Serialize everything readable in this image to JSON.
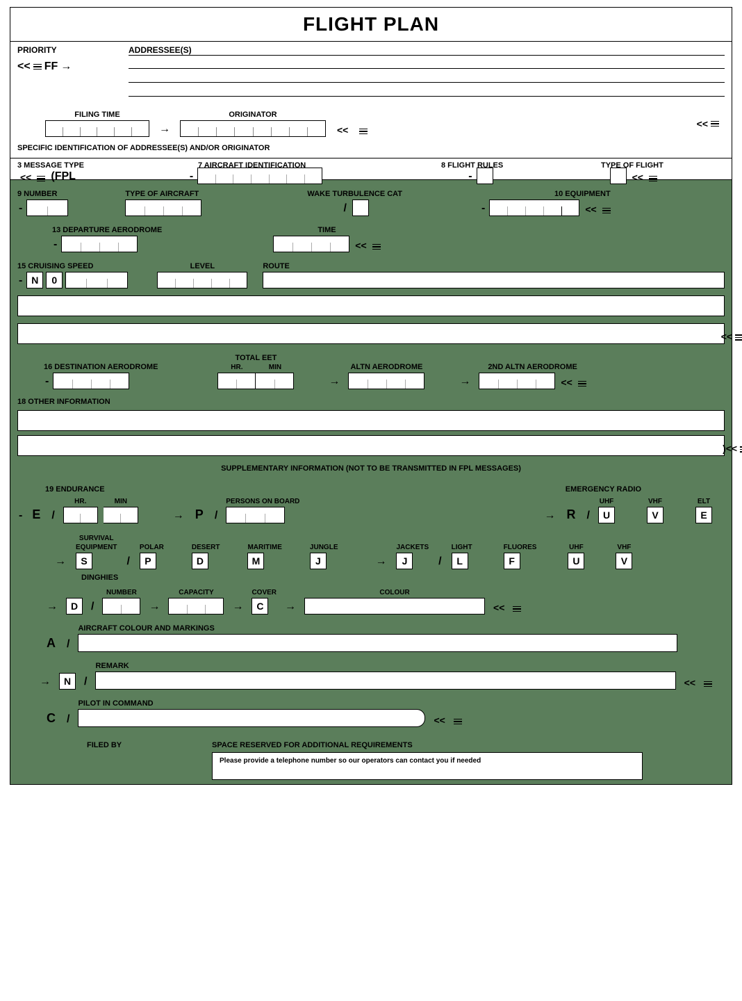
{
  "title": "FLIGHT PLAN",
  "top": {
    "priority": "PRIORITY",
    "addressees": "ADDRESSEE(S)",
    "ff": "FF",
    "filing_time": "FILING TIME",
    "originator": "ORIGINATOR",
    "spec_id": "SPECIFIC IDENTIFICATION OF ADDRESSEE(S) AND/OR ORIGINATOR"
  },
  "hdr": {
    "n3": "3  MESSAGE TYPE",
    "n7": "7  AIRCRAFT IDENTIFICATION",
    "n8": "8  FLIGHT RULES",
    "tof": "TYPE OF FLIGHT",
    "fpl": "(FPL"
  },
  "r9": {
    "num": "9  NUMBER",
    "toa": "TYPE OF AIRCRAFT",
    "wtc": "WAKE TURBULENCE CAT",
    "eq": "10  EQUIPMENT"
  },
  "r13": {
    "dep": "13  DEPARTURE AERODROME",
    "time": "TIME"
  },
  "r15": {
    "cs": "15  CRUISING SPEED",
    "lvl": "LEVEL",
    "route": "ROUTE",
    "n": "N",
    "zero": "0"
  },
  "r16": {
    "dest": "16  DESTINATION AERODROME",
    "eet": "TOTAL EET",
    "hr": "HR.",
    "min": "MIN",
    "altn": "ALTN AERODROME",
    "altn2": "2ND ALTN AERODROME"
  },
  "r18": {
    "other": "18  OTHER INFORMATION"
  },
  "supp": {
    "hdr": "SUPPLEMENTARY INFORMATION (NOT TO BE TRANSMITTED IN FPL MESSAGES)",
    "end": "19  ENDURANCE",
    "hr": "HR.",
    "min": "MIN",
    "pob": "PERSONS ON BOARD",
    "emerg": "EMERGENCY RADIO",
    "uhf": "UHF",
    "vhf": "VHF",
    "elt": "ELT"
  },
  "surv": {
    "label": "SURVIVAL",
    "label2": "EQUIPMENT",
    "polar": "POLAR",
    "desert": "DESERT",
    "maritime": "MARITIME",
    "jungle": "JUNGLE",
    "jackets": "JACKETS",
    "light": "LIGHT",
    "fluores": "FLUORES",
    "uhf": "UHF",
    "vhf": "VHF",
    "dinghies": "DINGHIES",
    "number": "NUMBER",
    "capacity": "CAPACITY",
    "cover": "COVER",
    "colour": "COLOUR"
  },
  "lower": {
    "acm": "AIRCRAFT COLOUR AND MARKINGS",
    "remark": "REMARK",
    "pic": "PILOT IN COMMAND",
    "filed": "FILED BY",
    "space": "SPACE RESERVED FOR ADDITIONAL REQUIREMENTS",
    "tel": "Please provide a telephone number so our operators can contact you if needed"
  },
  "letters": {
    "E": "E",
    "P": "P",
    "R": "R",
    "U": "U",
    "V": "V",
    "S": "S",
    "D": "D",
    "M": "M",
    "J": "J",
    "L": "L",
    "F": "F",
    "C": "C",
    "N": "N",
    "A": "A"
  },
  "sym": {
    "ll": "<<",
    "arrow": "→",
    "dash": "-",
    "slash": "/",
    "close": ")<<"
  }
}
